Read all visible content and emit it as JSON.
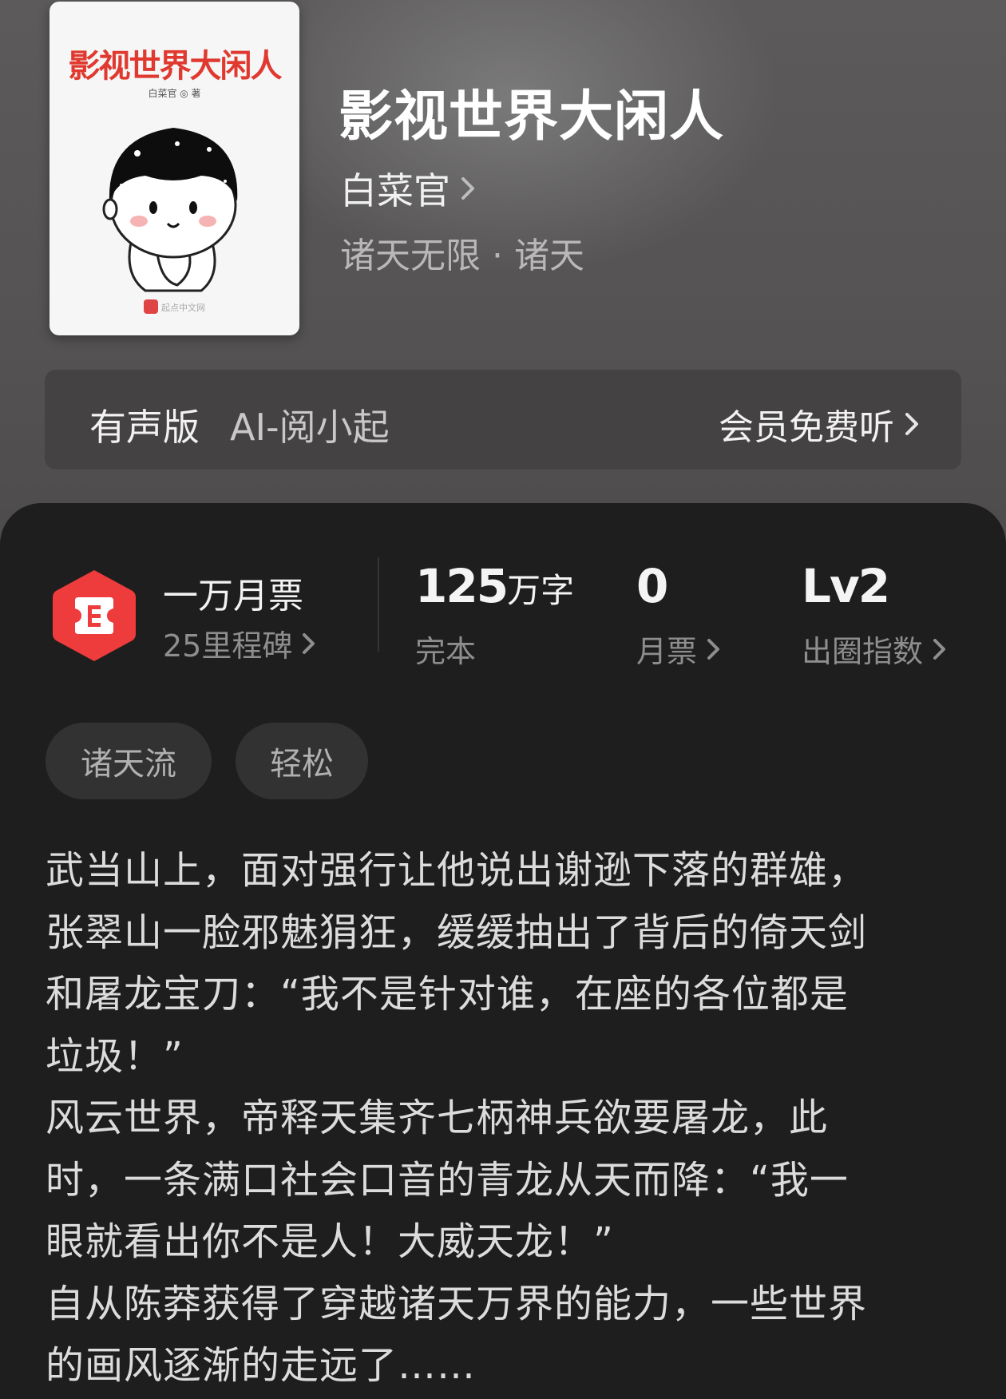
{
  "book": {
    "cover_title": "影视世界大闲人",
    "cover_author": "白菜官 ◎ 著",
    "cover_publisher": "起点中文网",
    "title": "影视世界大闲人",
    "author": "白菜官",
    "genre": "诸天无限 · 诸天"
  },
  "audio": {
    "label": "有声版",
    "narrator": "AI-阅小起",
    "action": "会员免费听"
  },
  "stats": {
    "monthly_ticket_badge": "一万月票",
    "milestone": "25里程碑",
    "words_num": "125",
    "words_unit": "万字",
    "status": "完本",
    "tickets_num": "0",
    "tickets_label": "月票",
    "level_num": "Lv2",
    "level_label": "出圈指数"
  },
  "tags": [
    "诸天流",
    "轻松"
  ],
  "intro": "武当山上，面对强行让他说出谢逊下落的群雄，\n张翠山一脸邪魅狷狂，缓缓抽出了背后的倚天剑\n和屠龙宝刀：“我不是针对谁，在座的各位都是\n垃圾！”\n风云世界，帝释天集齐七柄神兵欲要屠龙，此\n时，一条满口社会口音的青龙从天而降：“我一\n眼就看出你不是人！大威天龙！”\n自从陈莽获得了穿越诸天万界的能力，一些世界\n的画风逐渐的走远了……",
  "colors": {
    "hero_bg": "#5c5a5a",
    "panel_bg": "#1e1e1e",
    "badge_red": "#ee3b3b",
    "cover_title_red": "#e03a30"
  },
  "icons": [
    "chevron-right-icon",
    "monthly-ticket-badge-icon"
  ]
}
